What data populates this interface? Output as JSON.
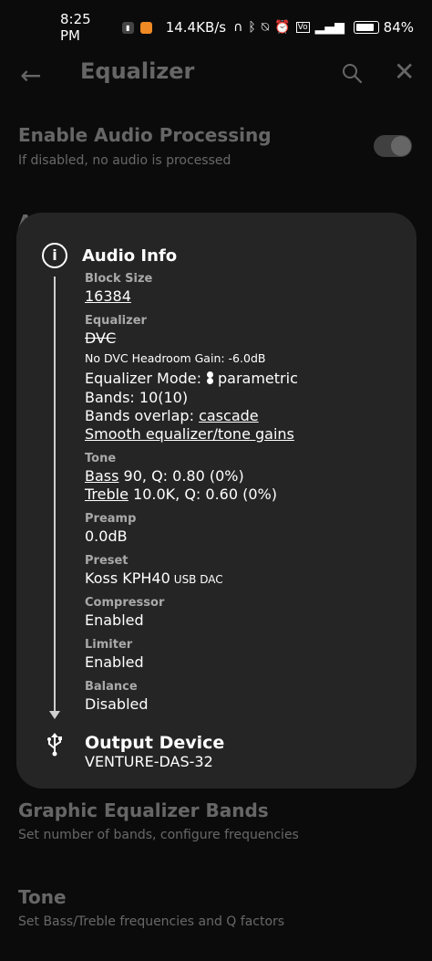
{
  "status_bar": {
    "time": "8:25 PM",
    "speed": "14.4KB/s",
    "battery": "84%",
    "icons": [
      "app-badge-icon",
      "app-icon",
      "headphones-icon",
      "bluetooth-icon",
      "mute-icon",
      "alarm-icon",
      "volte-icon",
      "signal-icon",
      "battery-icon"
    ]
  },
  "app_bar": {
    "title": "Equalizer",
    "back_icon": "arrow-back-icon",
    "search_icon": "search-icon",
    "close_icon": "close-icon"
  },
  "settings": {
    "enable_audio": {
      "title": "Enable Audio Processing",
      "subtitle": "If disabled, no audio is processed",
      "enabled": true
    },
    "partial_letter": "A",
    "graphic_eq": {
      "title": "Graphic Equalizer Bands",
      "subtitle": "Set number of bands, configure frequencies"
    },
    "tone": {
      "title": "Tone",
      "subtitle": "Set Bass/Treble frequencies and Q factors"
    }
  },
  "dialog": {
    "title": "Audio Info",
    "block_size": {
      "label": "Block Size",
      "value": "16384"
    },
    "equalizer": {
      "label": "Equalizer",
      "dvc": "DVC",
      "headroom": "No DVC Headroom Gain: -6.0dB",
      "mode_prefix": "Equalizer Mode:",
      "mode_value": "parametric",
      "bands": "Bands: 10(10)",
      "overlap_prefix": "Bands overlap:",
      "overlap_value": "cascade",
      "smooth": "Smooth equalizer/tone gains"
    },
    "tone": {
      "label": "Tone",
      "bass_label": "Bass",
      "bass_value": "90, Q: 0.80 (0%)",
      "treble_label": "Treble",
      "treble_value": "10.0K, Q: 0.60 (0%)"
    },
    "preamp": {
      "label": "Preamp",
      "value": "0.0dB"
    },
    "preset": {
      "label": "Preset",
      "value": "Koss KPH40",
      "tag": "USB DAC"
    },
    "compressor": {
      "label": "Compressor",
      "value": "Enabled"
    },
    "limiter": {
      "label": "Limiter",
      "value": "Enabled"
    },
    "balance": {
      "label": "Balance",
      "value": "Disabled"
    },
    "output": {
      "label": "Output Device",
      "value": "VENTURE-DAS-32"
    }
  },
  "colors": {
    "background": "#0b0b0b",
    "dialog": "#252526",
    "section_label": "#a9a9a9"
  }
}
